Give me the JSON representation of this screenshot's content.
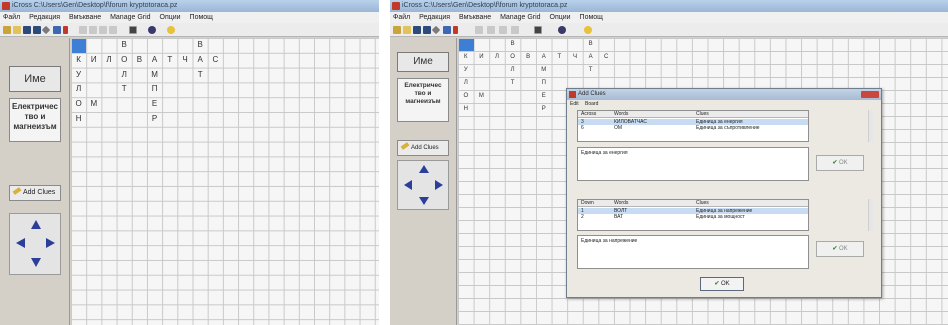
{
  "left_window": {
    "title": "iCross C:\\Users\\Gen\\Desktop\\f\\forum kryptotoraca.pz",
    "menu": [
      "Файл",
      "Редакция",
      "Вмъкване",
      "Manage Grid",
      "Опции",
      "Помощ"
    ],
    "name_label": "Име",
    "clue_info": [
      "Електричес",
      "тво и",
      "магнеизъм"
    ],
    "add_clues_label": "Add Clues"
  },
  "right_window": {
    "title": "iCross C:\\Users\\Gen\\Desktop\\f\\forum kryptotoraca.pz",
    "menu": [
      "Файл",
      "Редакция",
      "Вмъкване",
      "Manage Grid",
      "Опции",
      "Помощ"
    ],
    "name_label": "Име",
    "clue_info": [
      "Електричес",
      "тво и",
      "магнеизъм"
    ],
    "add_clues_label": "Add Clues"
  },
  "grid_letters": [
    {
      "r": 0,
      "c": 3,
      "ch": "В"
    },
    {
      "r": 0,
      "c": 8,
      "ch": "В"
    },
    {
      "r": 1,
      "c": 0,
      "ch": "К"
    },
    {
      "r": 1,
      "c": 1,
      "ch": "И"
    },
    {
      "r": 1,
      "c": 2,
      "ch": "Л"
    },
    {
      "r": 1,
      "c": 3,
      "ch": "О"
    },
    {
      "r": 1,
      "c": 4,
      "ch": "В"
    },
    {
      "r": 1,
      "c": 5,
      "ch": "А"
    },
    {
      "r": 1,
      "c": 6,
      "ch": "Т"
    },
    {
      "r": 1,
      "c": 7,
      "ch": "Ч"
    },
    {
      "r": 1,
      "c": 8,
      "ch": "А"
    },
    {
      "r": 1,
      "c": 9,
      "ch": "С"
    },
    {
      "r": 2,
      "c": 0,
      "ch": "У"
    },
    {
      "r": 2,
      "c": 3,
      "ch": "Л"
    },
    {
      "r": 2,
      "c": 5,
      "ch": "М"
    },
    {
      "r": 2,
      "c": 8,
      "ch": "Т"
    },
    {
      "r": 3,
      "c": 0,
      "ch": "Л"
    },
    {
      "r": 3,
      "c": 3,
      "ch": "Т"
    },
    {
      "r": 3,
      "c": 5,
      "ch": "П"
    },
    {
      "r": 4,
      "c": 0,
      "ch": "О"
    },
    {
      "r": 4,
      "c": 1,
      "ch": "М"
    },
    {
      "r": 4,
      "c": 5,
      "ch": "Е"
    },
    {
      "r": 5,
      "c": 0,
      "ch": "Н"
    },
    {
      "r": 5,
      "c": 5,
      "ch": "Р"
    }
  ],
  "dialog": {
    "title": "Add Clues",
    "menu": [
      "Edit",
      "Board"
    ],
    "across": {
      "headers": [
        "Across",
        "Words",
        "Clues"
      ],
      "rows": [
        {
          "num": "3",
          "word": "КИЛОВАТЧАС",
          "clue": "Единица за енергия"
        },
        {
          "num": "6",
          "word": "ОМ",
          "clue": "Единица за съпротивление"
        }
      ]
    },
    "across_text": "Единица за енергия",
    "down": {
      "headers": [
        "Down",
        "Words",
        "Clues"
      ],
      "rows": [
        {
          "num": "1",
          "word": "ВОЛТ",
          "clue": "Единица за напрежение"
        },
        {
          "num": "2",
          "word": "ВАТ",
          "clue": "Единица за мощност"
        }
      ]
    },
    "down_text": "Единица за напрежение",
    "small_ok": "OK",
    "ok": "OK"
  }
}
